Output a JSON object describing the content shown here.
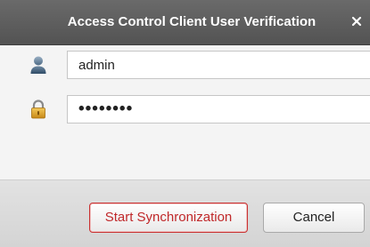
{
  "dialog": {
    "title": "Access Control Client User Verification",
    "close_icon": "close-icon"
  },
  "form": {
    "username": {
      "icon": "user-icon",
      "value": "admin"
    },
    "password": {
      "icon": "lock-icon",
      "value": "••••••••"
    }
  },
  "buttons": {
    "start_sync_label": "Start Synchronization",
    "cancel_label": "Cancel"
  },
  "colors": {
    "titlebar": "#5e5e5e",
    "primary_button_border": "#c93232",
    "primary_button_text": "#c0282a"
  }
}
